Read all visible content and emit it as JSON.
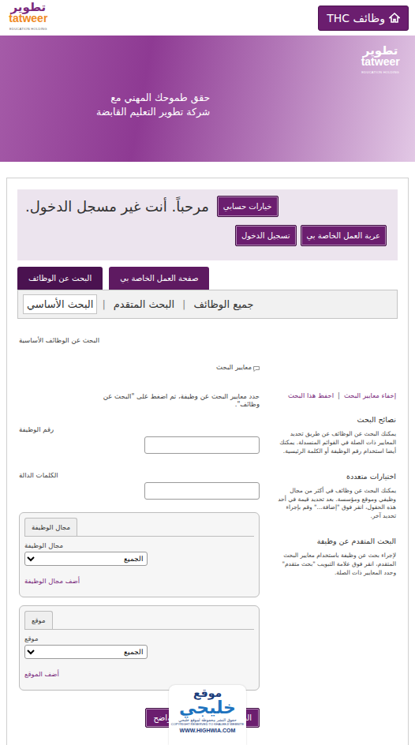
{
  "header": {
    "logo": {
      "ar": "تطوير",
      "en": "tatweer",
      "sub": "EDUCATION HOLDING"
    },
    "home_button": "THC وظائف"
  },
  "banner": {
    "lines": [
      "حقق طموحك المهني مع",
      "شركة تطوير التعليم القابضة"
    ],
    "logo": {
      "ar": "تطوير",
      "en": "tatweer",
      "sub": "EDUCATION HOLDING"
    }
  },
  "welcome": {
    "message": "مرحباً. أنت غير مسجل الدخول.",
    "account_button": "خيارات حسابي",
    "buttons": [
      "عربة العمل الخاصة بي",
      "تسجيل الدخول"
    ]
  },
  "tabs": [
    {
      "label": "البحث عن الوظائف",
      "selected": true
    },
    {
      "label": "صفحة العمل الخاصة بي",
      "selected": false
    }
  ],
  "subtabs": [
    {
      "label": "جميع الوظائف",
      "selected": false
    },
    {
      "label": "البحث المتقدم",
      "selected": false
    },
    {
      "label": "البحث الأساسي",
      "selected": true
    }
  ],
  "separator": "|",
  "search": {
    "title": "البحث عن الوظائف الأساسية",
    "criteria_label": "معايير البحث",
    "instruction": "حدد معايير البحث عن وظيفة، ثم اضغط على \"البحث عن وظائف\".",
    "links": [
      "إخفاء معايير البحث",
      "احفظ هذا البحث"
    ],
    "fields": [
      {
        "label": "رقم الوظيفة"
      },
      {
        "label": "الكلمات الدالة"
      }
    ],
    "groups": [
      {
        "tab": "مجال الوظيفة",
        "label": "مجال الوظيفة",
        "value": "الجميع",
        "add_link": "أضف مجال الوظيفة"
      },
      {
        "tab": "موقع",
        "label": "موقع",
        "value": "الجميع",
        "add_link": "أضف الموقع"
      }
    ],
    "buttons": [
      "البحث عن وظائف",
      "واضح"
    ]
  },
  "tips": [
    {
      "title": "نصائح البحث",
      "text": "يمكنك البحث عن الوظائف عن طريق تحديد المعايير ذات الصلة في القوائم المنسدلة. يمكنك أيضا استخدام رقم الوظيفة أو الكلمة الرئيسية."
    },
    {
      "title": "اختيارات متعددة",
      "text": "يمكنك البحث عن وظائف في أكثر من مجال وظيفي وموقع ومؤسسة. بعد تحديد قيمة في أحد هذه الحقول، انقر فوق \"إضافة...\" وقم بإجراء تحديد آخر."
    },
    {
      "title": "البحث المتقدم عن وظيفة",
      "text": "لإجراء بحث عن وظيفة باستخدام معايير البحث المتقدم، انقر فوق علامة التبويب \"بحث متقدم\" وحدد المعايير ذات الصلة."
    }
  ],
  "watermark": {
    "top": "موقع",
    "name": "خليجي",
    "rights": "حقوق النشر محفوظة لموقع خليجي",
    "copyright": "COPYRIGHT RESERVED TO KHALEEJI WEBSITE",
    "url": "WWW.HIGHWIA.COM"
  }
}
